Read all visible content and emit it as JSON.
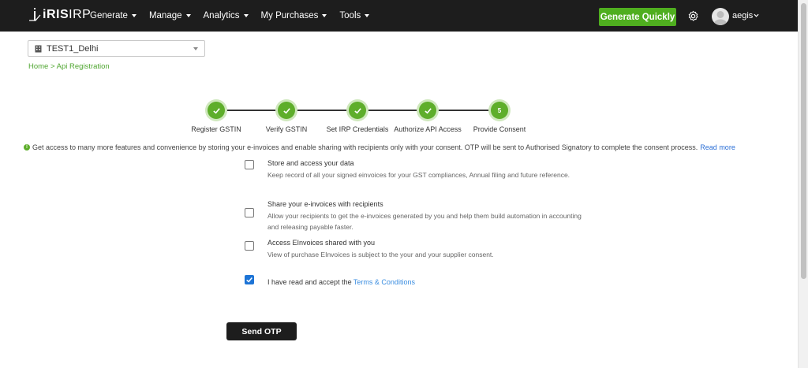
{
  "app": {
    "logo_text_bold": "iRIS",
    "logo_text_thin": "IRP"
  },
  "nav": {
    "items": [
      {
        "label": "Generate"
      },
      {
        "label": "Manage"
      },
      {
        "label": "Analytics"
      },
      {
        "label": "My Purchases"
      },
      {
        "label": "Tools"
      }
    ],
    "generate_quickly": "Generate Quickly",
    "settings_icon": "gear-icon",
    "user_name": "aegis"
  },
  "branch_select": {
    "value": "TEST1_Delhi",
    "icon": "building-icon"
  },
  "breadcrumb": "Home > Api Registration",
  "steps": [
    {
      "label": "Register GSTIN",
      "state": "done"
    },
    {
      "label": "Verify GSTIN",
      "state": "done"
    },
    {
      "label": "Set IRP Credentials",
      "state": "done"
    },
    {
      "label": "Authorize API Access",
      "state": "done"
    },
    {
      "label": "Provide Consent",
      "state": "current",
      "number": "5"
    }
  ],
  "info": {
    "text": "Get access to many more features and convenience by storing your e-invoices and enable sharing with recipients only with your consent. OTP will be sent to Authorised Signatory to complete the consent process.",
    "link": "Read more"
  },
  "options": [
    {
      "title": "Store and access your data",
      "description": "Keep record of all your signed einvoices for your GST compliances, Annual filing and future reference.",
      "checked": false
    },
    {
      "title": "Share your e-invoices with recipients",
      "description": "Allow your recipients to get the e-invoices generated by you and help them build automation in accounting and releasing payable faster.",
      "checked": false
    },
    {
      "title": "Access EInvoices shared with you",
      "description": "View of purchase EInvoices is subject to the your and your supplier consent.",
      "checked": false
    }
  ],
  "terms": {
    "text": "I have read and accept the",
    "link": "Terms & Conditions",
    "checked": true
  },
  "send_otp": "Send OTP",
  "colors": {
    "navbar": "#1d1d1d",
    "accent_green": "#4fae1f",
    "link_blue": "#2b6fd6",
    "checkbox_blue": "#1d74d6"
  }
}
